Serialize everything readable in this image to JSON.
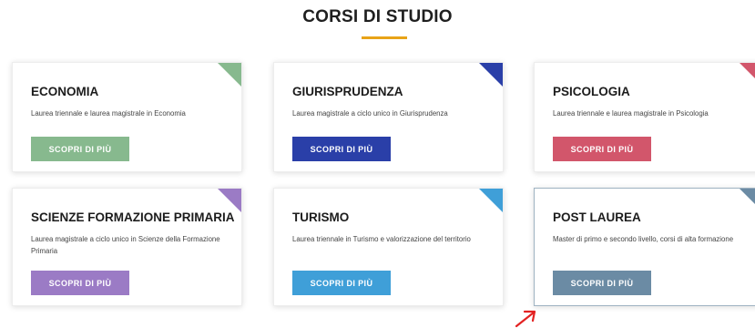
{
  "section": {
    "title": "CORSI DI STUDIO"
  },
  "cards": [
    {
      "title": "ECONOMIA",
      "description": "Laurea triennale e laurea magistrale in Economia",
      "cta": "SCOPRI DI PIÙ",
      "accent": "#87b98e"
    },
    {
      "title": "GIURISPRUDENZA",
      "description": "Laurea magistrale a ciclo unico in Giurisprudenza",
      "cta": "SCOPRI DI PIÙ",
      "accent": "#2a3fa8"
    },
    {
      "title": "PSICOLOGIA",
      "description": "Laurea triennale e laurea magistrale in Psicologia",
      "cta": "SCOPRI DI PIÙ",
      "accent": "#d2566b"
    },
    {
      "title": "SCIENZE FORMAZIONE PRIMARIA",
      "description": "Laurea magistrale a ciclo unico in Scienze della Formazione Primaria",
      "cta": "SCOPRI DI PIÙ",
      "accent": "#9b7bc5"
    },
    {
      "title": "TURISMO",
      "description": "Laurea triennale in Turismo e valorizzazione del territorio",
      "cta": "SCOPRI DI PIÙ",
      "accent": "#3f9fd8"
    },
    {
      "title": "POST LAUREA",
      "description": "Master di primo e secondo livello, corsi di alta formazione",
      "cta": "SCOPRI DI PIÙ",
      "accent": "#6b8ba4"
    }
  ],
  "colors": {
    "title_underline": "#e8a318",
    "annotation_arrow": "#e32222"
  }
}
